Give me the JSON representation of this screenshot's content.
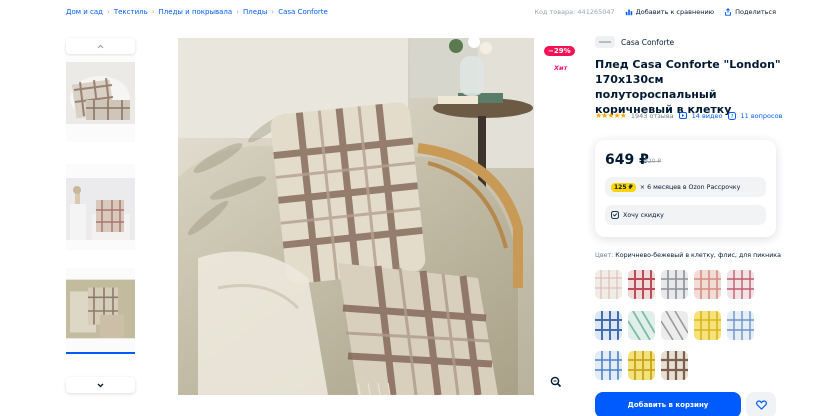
{
  "breadcrumbs": [
    "Дом и сад",
    "Текстиль",
    "Пледы и покрывала",
    "Пледы",
    "Casa Conforte"
  ],
  "top_actions": {
    "code": "Код товара: 441265047",
    "compare": "Добавить к сравнению",
    "share": "Поделиться"
  },
  "badges": {
    "discount": "−29%",
    "hit": "Хит"
  },
  "brand": {
    "name": "Casa Conforte"
  },
  "product": {
    "title": "Плед Casa Conforte \"London\" 170х130см полутороспальный коричневый в клетку",
    "reviews": "1943 отзыва",
    "videos": "14 видео",
    "questions": "11 вопросов",
    "stars": "★★★★★"
  },
  "price": {
    "current": "649 ₽",
    "old": "920 ₽",
    "installment_amount": "125 ₽",
    "installment_text": "× 6 месяцев в Ozon Рассрочку",
    "want_discount": "Хочу скидку"
  },
  "color": {
    "label": "Цвет:",
    "value": "Коричнево-бежевый в клетку, флис, для пикника"
  },
  "cart": {
    "add_label": "Добавить в корзину"
  },
  "colors": {
    "accent": "#005bff",
    "discount": "#f91155",
    "star": "#ffa800",
    "installment": "#ffd400"
  },
  "icons": [
    "chevron-up-icon",
    "chevron-down-icon",
    "compare-icon",
    "share-icon",
    "video-icon",
    "question-icon",
    "discount-icon",
    "zoom-icon",
    "heart-icon"
  ]
}
